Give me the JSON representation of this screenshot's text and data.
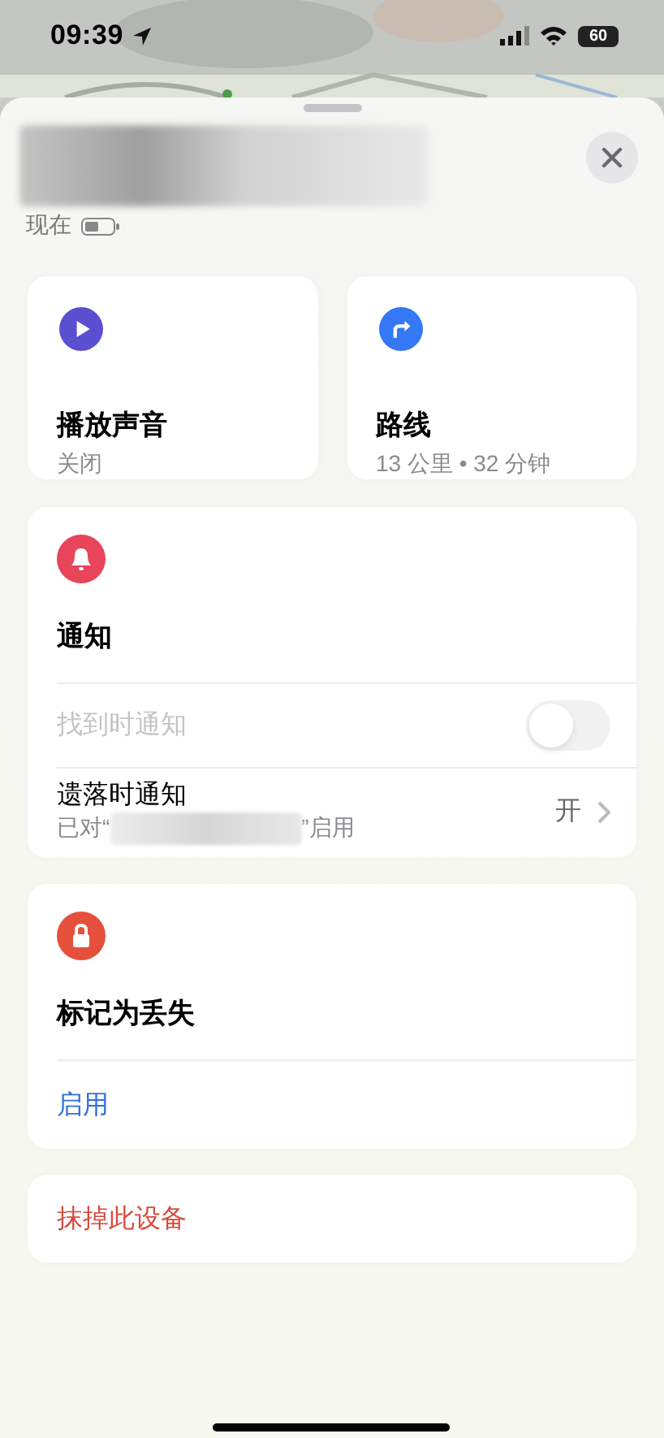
{
  "status_bar": {
    "time": "09:39",
    "battery": "60"
  },
  "device": {
    "updated": "现在"
  },
  "actions": [
    {
      "kind": "sound",
      "title": "播放声音",
      "detail": "关闭"
    },
    {
      "kind": "directions",
      "title": "路线",
      "detail": "13 公里 • 32 分钟"
    }
  ],
  "notifications": {
    "title": "通知",
    "rows": [
      {
        "kind": "toggle",
        "label": "找到时通知",
        "disabled": true,
        "on": false
      },
      {
        "kind": "link",
        "label": "遗落时通知",
        "detail_before": "已对“",
        "detail_after": "”启用",
        "value": "开"
      }
    ]
  },
  "lost_mode": {
    "title": "标记为丢失",
    "action": "启用"
  },
  "erase": {
    "label": "抹掉此设备"
  }
}
